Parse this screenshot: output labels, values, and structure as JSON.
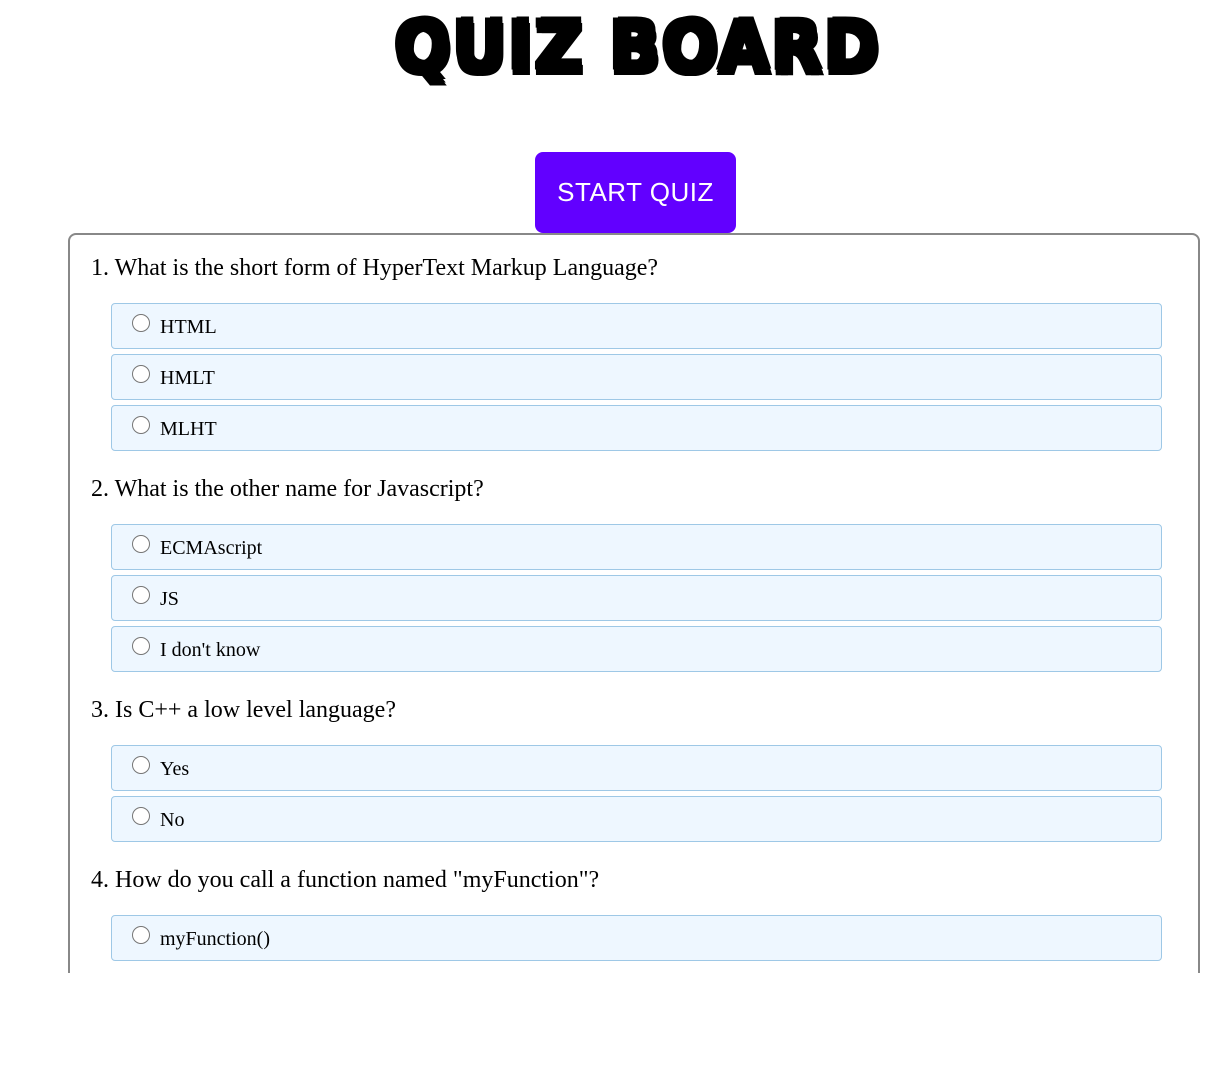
{
  "header": {
    "title": "QUIZ BOARD"
  },
  "start_button": {
    "label": "START QUIZ",
    "color": "#6200ff"
  },
  "questions": [
    {
      "text": "1. What is the short form of HyperText Markup Language?",
      "options": [
        "HTML",
        "HMLT",
        "MLHT"
      ]
    },
    {
      "text": "2. What is the other name for Javascript?",
      "options": [
        "ECMAscript",
        "JS",
        "I don't know"
      ]
    },
    {
      "text": "3. Is C++ a low level language?",
      "options": [
        "Yes",
        "No"
      ]
    },
    {
      "text": "4. How do you call a function named \"myFunction\"?",
      "options": [
        "myFunction()"
      ]
    }
  ]
}
